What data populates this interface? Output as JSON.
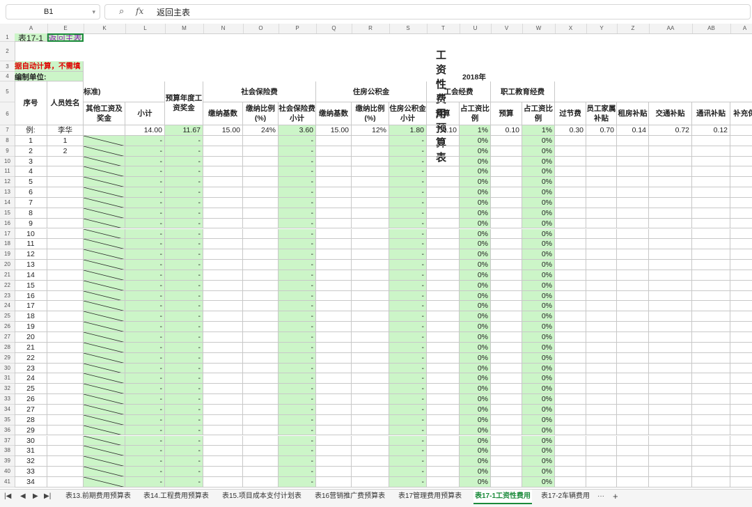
{
  "formula_bar": {
    "cell_ref": "B1",
    "content": "返回主表",
    "fx": "fx"
  },
  "columns": [
    "A",
    "E",
    "K",
    "L",
    "M",
    "N",
    "O",
    "P",
    "Q",
    "R",
    "S",
    "T",
    "U",
    "V",
    "W",
    "X",
    "Y",
    "Z",
    "AA",
    "AB",
    "A"
  ],
  "sheet": {
    "a1": "表17-1",
    "b1_link": "返回主表",
    "title": "工资性费用预算表",
    "note": "据自动计算，不需填",
    "unit_label": "编制单位:",
    "year": "2018年",
    "h_std": "标准)",
    "h_seq": "序号",
    "h_name": "人员姓名",
    "h_other": "其他工资及奖金",
    "h_subtotal": "小计",
    "h_budget_bonus": "预算年度工资奖金",
    "h_social": "社会保险费",
    "h_s_base": "缴纳基数",
    "h_s_ratio": "缴纳比例(%)",
    "h_s_sub": "社会保险费小计",
    "h_housing": "住房公积金",
    "h_h_base": "缴纳基数",
    "h_h_ratio": "缴纳比例(%)",
    "h_h_sub": "住房公积金小计",
    "h_union": "工会经费",
    "h_u_budget": "预算",
    "h_u_ratio": "占工资比例",
    "h_edu": "职工教育经费",
    "h_e_budget": "预算",
    "h_e_ratio": "占工资比例",
    "h_holiday": "过节费",
    "h_family": "员工家属补贴",
    "h_rent": "租房补贴",
    "h_transport": "交通补贴",
    "h_comm": "通讯补贴",
    "h_extra": "补充保",
    "example": {
      "seq": "例:",
      "name": "李华",
      "subtotal": "14.00",
      "bonus": "11.67",
      "s_base": "15.00",
      "s_ratio": "24%",
      "s_sub": "3.60",
      "h_base": "15.00",
      "h_ratio": "12%",
      "h_sub": "1.80",
      "u_budget": "0.10",
      "u_ratio": "1%",
      "e_budget": "0.10",
      "e_ratio": "1%",
      "holiday": "0.30",
      "family": "0.70",
      "rent": "0.14",
      "transport": "0.72",
      "comm": "0.12"
    },
    "row_names": {
      "1": "1",
      "2": "2"
    },
    "dash": "-",
    "zero_pct": "0%"
  },
  "row_numbers": [
    "1",
    "2",
    "3",
    "4",
    "5",
    "6",
    "7",
    "8",
    "9",
    "10",
    "11",
    "12",
    "13",
    "14",
    "15",
    "16",
    "17",
    "18",
    "19",
    "20",
    "21",
    "22",
    "23",
    "24",
    "25",
    "26",
    "27",
    "28",
    "29",
    "30",
    "31",
    "32",
    "33",
    "34",
    "35",
    "36",
    "37",
    "38",
    "39",
    "40",
    "41"
  ],
  "seq_numbers": [
    "1",
    "2",
    "3",
    "4",
    "5",
    "6",
    "7",
    "8",
    "9",
    "10",
    "11",
    "12",
    "13",
    "14",
    "15",
    "16",
    "17",
    "18",
    "19",
    "20",
    "21",
    "22",
    "23",
    "24",
    "25",
    "26",
    "27",
    "28",
    "29",
    "30",
    "31",
    "32",
    "33",
    "34"
  ],
  "tabs": [
    "表13.前期费用预算表",
    "表14.工程费用预算表",
    "表15.项目成本支付计划表",
    "表16营销推广费预算表",
    "表17管理费用预算表",
    "表17-1工资性费用",
    "表17-2车辆费用"
  ],
  "active_tab": "表17-1工资性费用",
  "tab_more": "···",
  "tab_add": "+"
}
